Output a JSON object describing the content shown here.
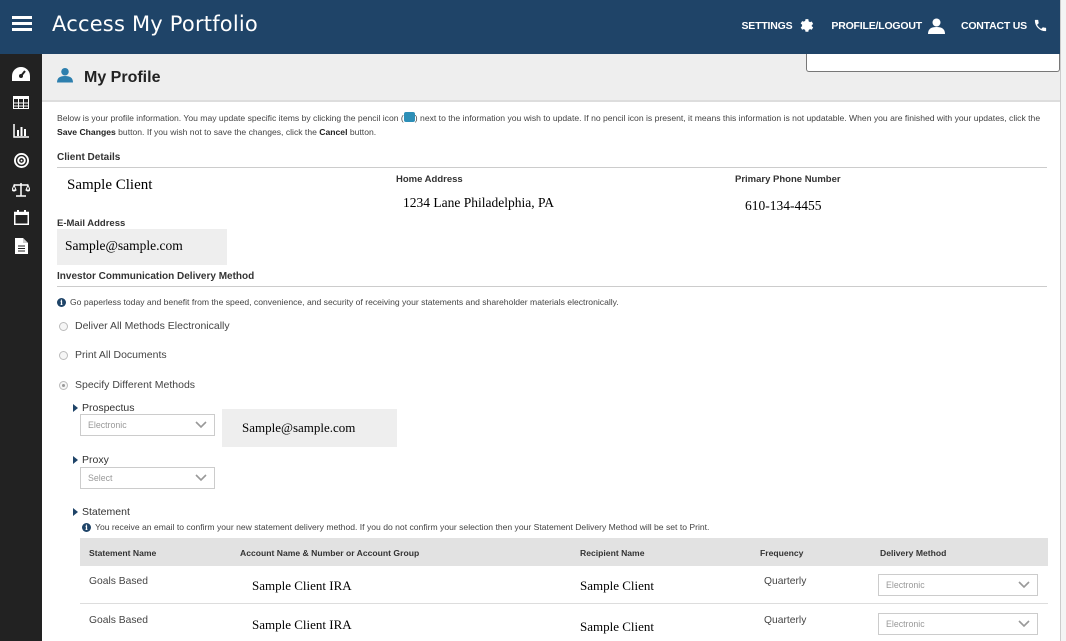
{
  "header": {
    "title": "Access My Portfolio",
    "settings_label": "SETTINGS",
    "profile_label": "PROFILE/LOGOUT",
    "contact_label": "CONTACT US"
  },
  "sidebar": {
    "items": [
      {
        "icon": "dashboard-gauge-icon"
      },
      {
        "icon": "table-grid-icon"
      },
      {
        "icon": "bar-chart-icon"
      },
      {
        "icon": "target-icon"
      },
      {
        "icon": "balance-scale-icon"
      },
      {
        "icon": "calendar-icon"
      },
      {
        "icon": "document-icon"
      }
    ]
  },
  "page": {
    "title": "My Profile",
    "intro_1": "Below is your profile information. You may update specific items by clicking the pencil icon (",
    "intro_2": ") next to the information you wish to update. If no pencil icon is present, it means this information is not updatable. When you are finished with your updates, click the ",
    "intro_save": "Save Changes",
    "intro_3": " button. If you wish not to save the changes, click the ",
    "intro_cancel": "Cancel",
    "intro_4": " button."
  },
  "client": {
    "section_title": "Client Details",
    "name": "Sample Client",
    "home_address_label": "Home Address",
    "home_address": "1234 Lane Philadelphia, PA",
    "phone_label": "Primary Phone Number",
    "phone": "610-134-4455",
    "email_label": "E-Mail Address",
    "email": "Sample@sample.com"
  },
  "delivery": {
    "section_title": "Investor Communication Delivery Method",
    "info": "Go paperless today and benefit from the speed, convenience, and security of receiving your statements and shareholder materials electronically.",
    "options": [
      {
        "label": "Deliver All Methods Electronically",
        "selected": false
      },
      {
        "label": "Print All Documents",
        "selected": false
      },
      {
        "label": "Specify Different Methods",
        "selected": true
      }
    ],
    "prospectus_label": "Prospectus",
    "prospectus_value": "Electronic",
    "prospectus_email": "Sample@sample.com",
    "proxy_label": "Proxy",
    "proxy_value": "Select",
    "statement_label": "Statement",
    "statement_info": "You receive an email to confirm your new statement delivery method. If you do not confirm your selection then your Statement Delivery Method will be set to Print."
  },
  "statement_table": {
    "columns": [
      "Statement Name",
      "Account Name & Number or Account Group",
      "Recipient Name",
      "Frequency",
      "Delivery Method"
    ],
    "rows": [
      {
        "statement": "Goals Based",
        "account": "Sample Client IRA",
        "recipient": "Sample Client",
        "frequency": "Quarterly",
        "delivery": "Electronic"
      },
      {
        "statement": "Goals Based",
        "account": "Sample Client IRA",
        "recipient": "Sample Client",
        "frequency": "Quarterly",
        "delivery": "Electronic"
      }
    ]
  }
}
